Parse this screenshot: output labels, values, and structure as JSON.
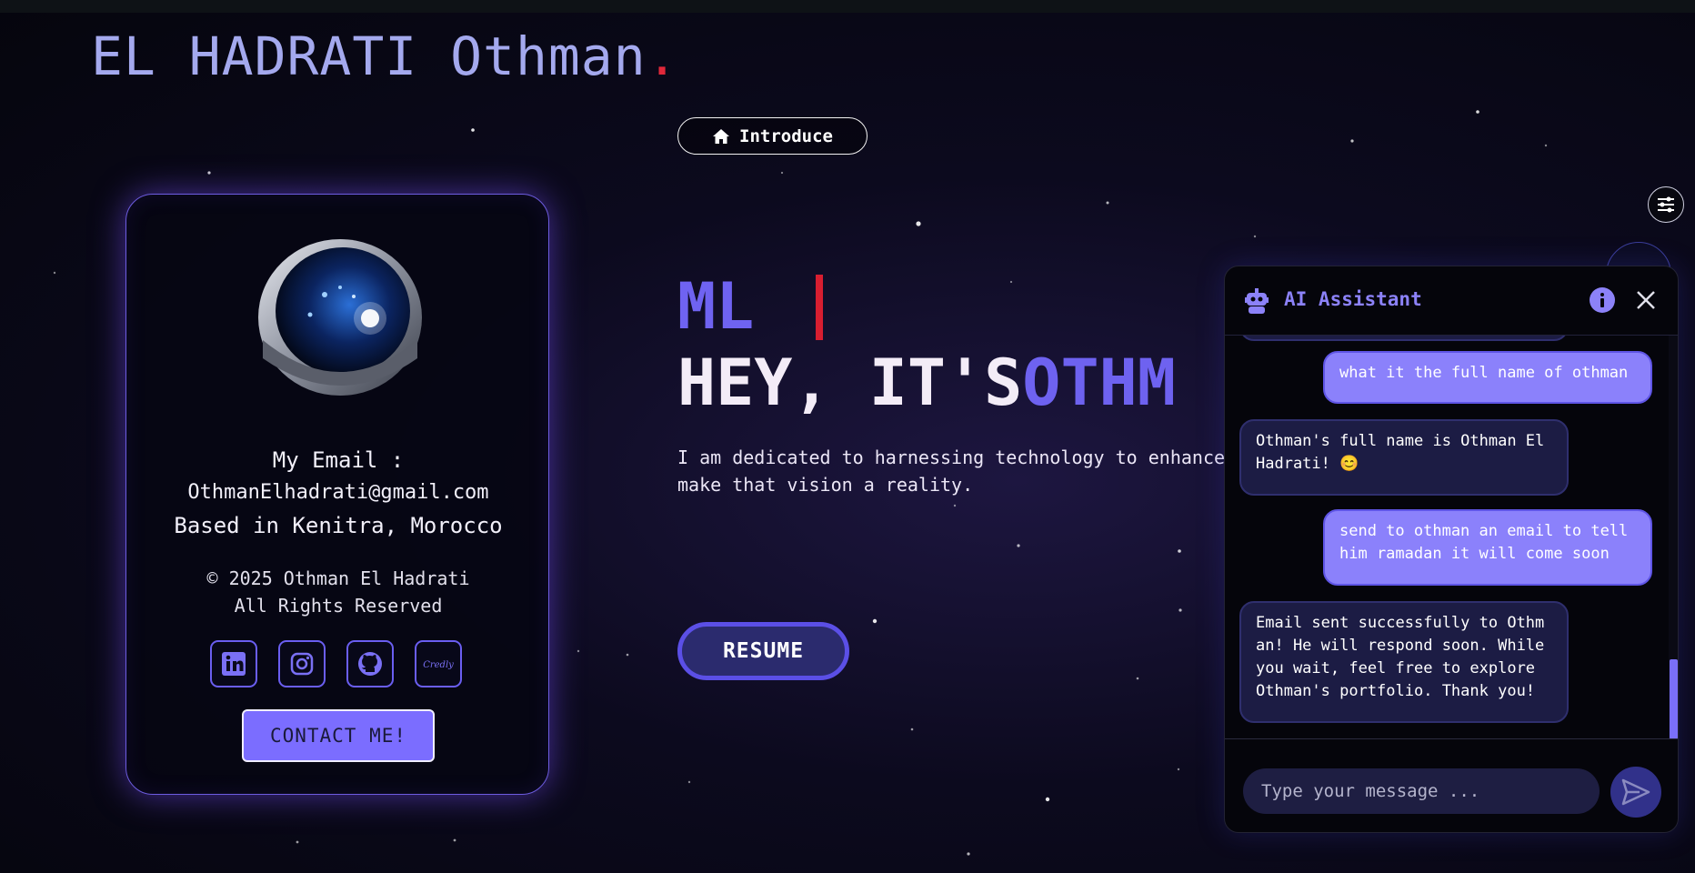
{
  "site": {
    "title": "EL HADRATI Othman",
    "title_dot": "."
  },
  "profile": {
    "email_label": "My Email :",
    "email": "OthmanElhadrati@gmail.com",
    "location": "Based in Kenitra, Morocco",
    "copyright": "© 2025 Othman El Hadrati",
    "rights": "All Rights Reserved",
    "socials": [
      {
        "name": "linkedin",
        "icon": "linkedin-icon"
      },
      {
        "name": "instagram",
        "icon": "instagram-icon"
      },
      {
        "name": "github",
        "icon": "github-icon"
      },
      {
        "name": "credly",
        "icon": "credly-icon",
        "text": "Credly"
      }
    ],
    "contact_label": "CONTACT ME!"
  },
  "hero": {
    "intro_label": "Introduce",
    "intro_icon": "home-icon",
    "typing_text": "ML",
    "headline_prefix": "HEY, IT'S",
    "headline_name": "OTHM",
    "description_line1": "I am dedicated to harnessing technology to enhance",
    "description_line2": "make that vision a reality.",
    "resume_label": "RESUME"
  },
  "chat": {
    "title": "AI Assistant",
    "messages": [
      {
        "role": "user",
        "text": "what it the full name of othman"
      },
      {
        "role": "bot",
        "text": "Othman's full name is Othman El Hadrati! 😊"
      },
      {
        "role": "user",
        "text": "send to othman an email to tell him ramadan it will come soon"
      },
      {
        "role": "bot",
        "text": "Email sent successfully to Othman! He will respond soon. While you wait, feel free to explore Othman's portfolio. Thank you!"
      }
    ],
    "input_placeholder": "Type your message ..."
  },
  "colors": {
    "accent": "#6f63f1",
    "user_bubble": "#8b81fb",
    "bot_bubble": "#1c1c44",
    "cursor": "#d81e30",
    "contact_button": "#7b6dff"
  }
}
